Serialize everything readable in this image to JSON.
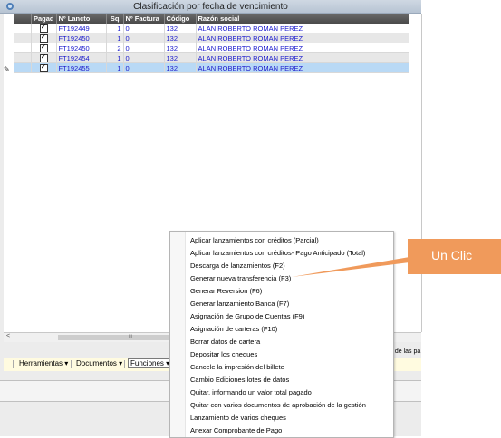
{
  "window": {
    "title": "Clasificación por fecha de vencimiento"
  },
  "grid": {
    "columns": [
      "Pagad",
      "Nº Lancto",
      "Sq.",
      "Nº Factura",
      "Código",
      "Razón social"
    ],
    "rows": [
      {
        "nlancto": "FT192449",
        "sq": "1",
        "factura": "0",
        "codigo": "132",
        "razon": "ALAN ROBERTO ROMAN PEREZ"
      },
      {
        "nlancto": "FT192450",
        "sq": "1",
        "factura": "0",
        "codigo": "132",
        "razon": "ALAN ROBERTO ROMAN PEREZ"
      },
      {
        "nlancto": "FT192450",
        "sq": "2",
        "factura": "0",
        "codigo": "132",
        "razon": "ALAN ROBERTO ROMAN PEREZ"
      },
      {
        "nlancto": "FT192454",
        "sq": "1",
        "factura": "0",
        "codigo": "132",
        "razon": "ALAN ROBERTO ROMAN PEREZ"
      },
      {
        "nlancto": "FT192455",
        "sq": "1",
        "factura": "0",
        "codigo": "132",
        "razon": "ALAN ROBERTO ROMAN PEREZ"
      }
    ]
  },
  "toolbar": {
    "herramientas": "Herramientas",
    "documentos": "Documentos",
    "funciones": "Funciones",
    "partial_text": "a de las pa"
  },
  "menu": {
    "items": [
      "Aplicar lanzamientos con créditos (Parcial)",
      "Aplicar lanzamientos con créditos- Pago Anticipado (Total)",
      "Descarga de lanzamientos (F2)",
      "Generar nueva transferencia (F3)",
      "Generar Reversion (F6)",
      "Generar lanzamiento Banca (F7)",
      "Asignación de Grupo de Cuentas (F9)",
      "Asignación de carteras (F10)",
      "Borrar datos de cartera",
      "Depositar los cheques",
      "Cancele la impresión del billete",
      "Cambio Ediciones lotes de datos",
      "Quitar, informando un valor total pagado",
      "Quitar con varios documentos de aprobación de la gestión",
      "Lanzamiento de varios cheques",
      "Anexar Comprobante de Pago"
    ]
  },
  "callout": {
    "text": "Un Clic"
  },
  "colors": {
    "callout": "#f09a5b",
    "selected_row": "#b9d9f5",
    "link_text": "#1a1acc"
  }
}
